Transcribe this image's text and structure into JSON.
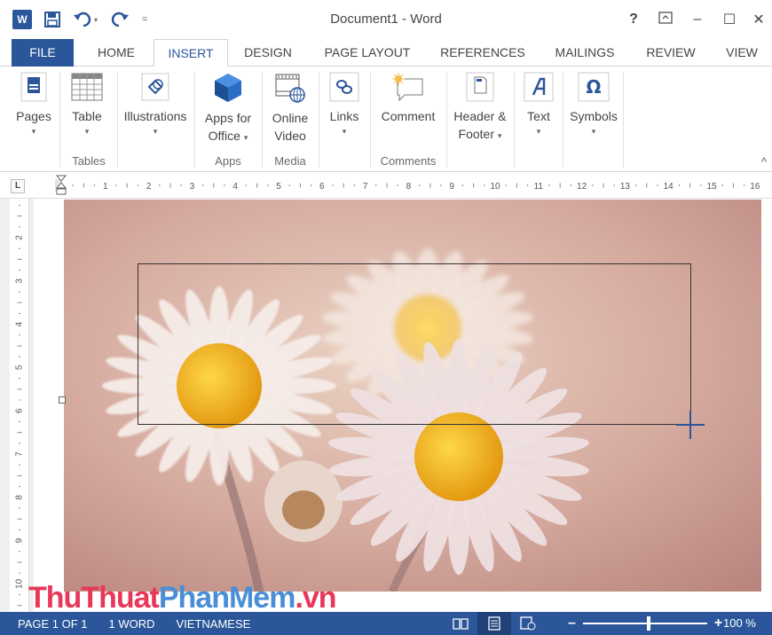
{
  "app": {
    "title": "Document1 - Word",
    "logo_letter": "W"
  },
  "qat": {
    "save_icon": "save-icon",
    "undo_icon": "undo-icon",
    "redo_icon": "redo-icon",
    "customize_icon": "customize-icon"
  },
  "window": {
    "help": "?",
    "ribbon_display": "ribbon-display-icon",
    "minimize": "–",
    "maximize": "☐",
    "close": "✕"
  },
  "tabs": [
    "FILE",
    "HOME",
    "INSERT",
    "DESIGN",
    "PAGE LAYOUT",
    "REFERENCES",
    "MAILINGS",
    "REVIEW",
    "VIEW"
  ],
  "active_tab": "INSERT",
  "ribbon": {
    "pages": {
      "label": "Pages"
    },
    "table": {
      "label": "Table"
    },
    "illustrations": {
      "label": "Illustrations"
    },
    "apps": {
      "line1": "Apps for",
      "line2": "Office"
    },
    "video": {
      "line1": "Online",
      "line2": "Video"
    },
    "links": {
      "label": "Links"
    },
    "comment": {
      "label": "Comment"
    },
    "header": {
      "line1": "Header &",
      "line2": "Footer"
    },
    "text": {
      "label": "Text"
    },
    "symbols": {
      "label": "Symbols"
    },
    "groups": {
      "tables": "Tables",
      "apps": "Apps",
      "media": "Media",
      "comments": "Comments"
    },
    "caret": "▾",
    "collapse": "^"
  },
  "ruler": {
    "tab_selector": "L",
    "numbers": [
      "1",
      "2",
      "3",
      "4",
      "5",
      "6",
      "7",
      "8",
      "9",
      "10",
      "11",
      "12",
      "13",
      "14",
      "15",
      "16"
    ]
  },
  "vruler": {
    "numbers": [
      "2",
      "3",
      "4",
      "5",
      "6",
      "7",
      "8",
      "9",
      "10"
    ]
  },
  "watermark": {
    "part1": "ThuThuat",
    "part2": "PhanMem",
    "part3": ".vn"
  },
  "status": {
    "page": "PAGE 1 OF 1",
    "words": "1 WORD",
    "language": "VIETNAMESE",
    "zoom_minus": "–",
    "zoom_plus": "+",
    "zoom_level": "100 %",
    "zoom_value": 100
  },
  "colors": {
    "accent": "#2b579a",
    "watermark_red": "#e9375a",
    "watermark_blue": "#4a8fd6"
  }
}
